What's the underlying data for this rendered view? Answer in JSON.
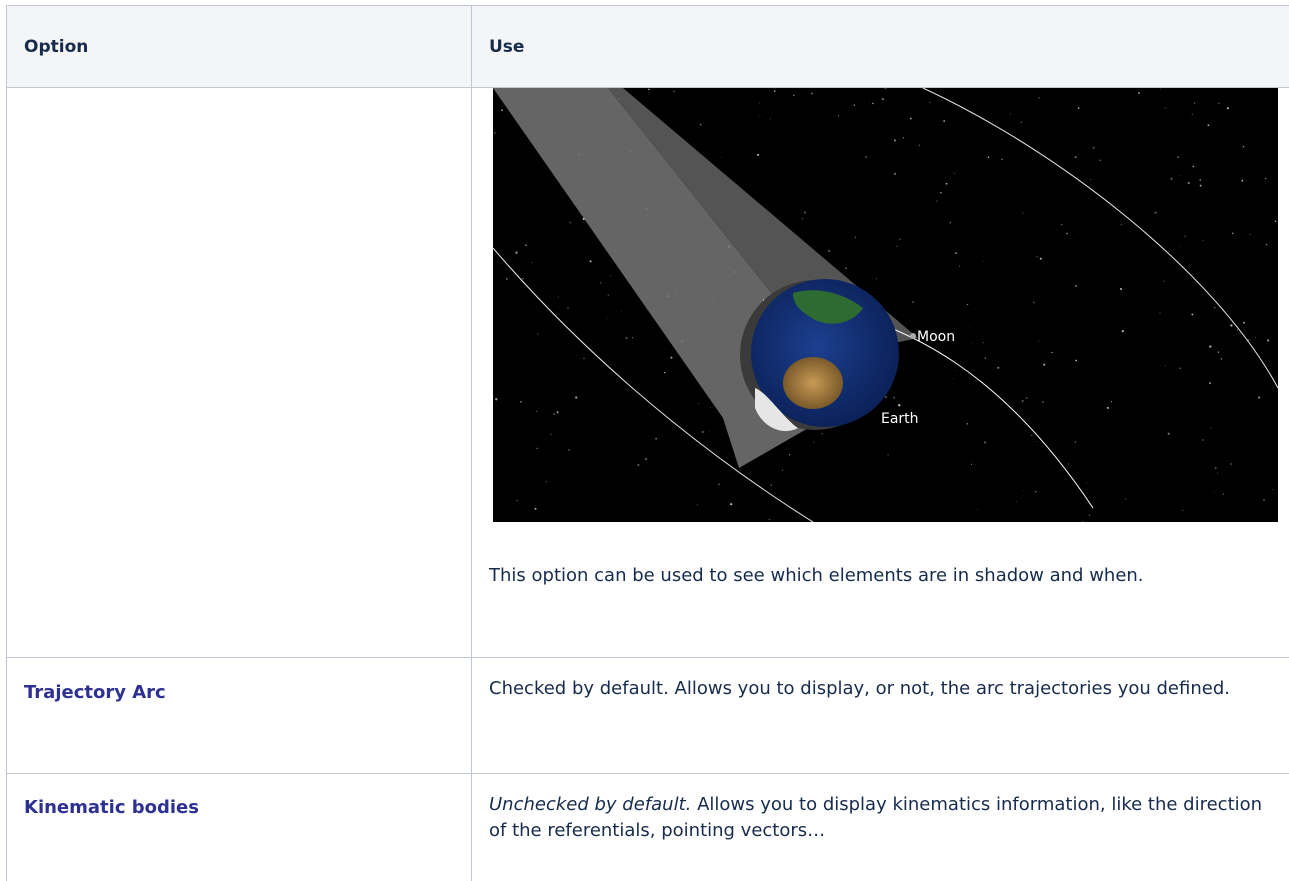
{
  "table": {
    "headers": {
      "option": "Option",
      "use": "Use"
    },
    "rows": [
      {
        "option": "",
        "image": {
          "labels": {
            "moon": "Moon",
            "earth": "Earth"
          }
        },
        "use": "This option can be used to see which elements are in shadow and when."
      },
      {
        "option": "Trajectory Arc",
        "use": "Checked by default. Allows you to display, or not, the arc trajectories you defined."
      },
      {
        "option": "Kinematic bodies",
        "use_italic": "Unchecked by default.",
        "use": "Allows you to display kinematics information, like the direction of the referentials, pointing vectors…"
      }
    ]
  },
  "colors": {
    "link": "#2e3192",
    "header_bg": "#f4f5f7",
    "border": "#c1c7d0",
    "text": "#172b4d"
  }
}
